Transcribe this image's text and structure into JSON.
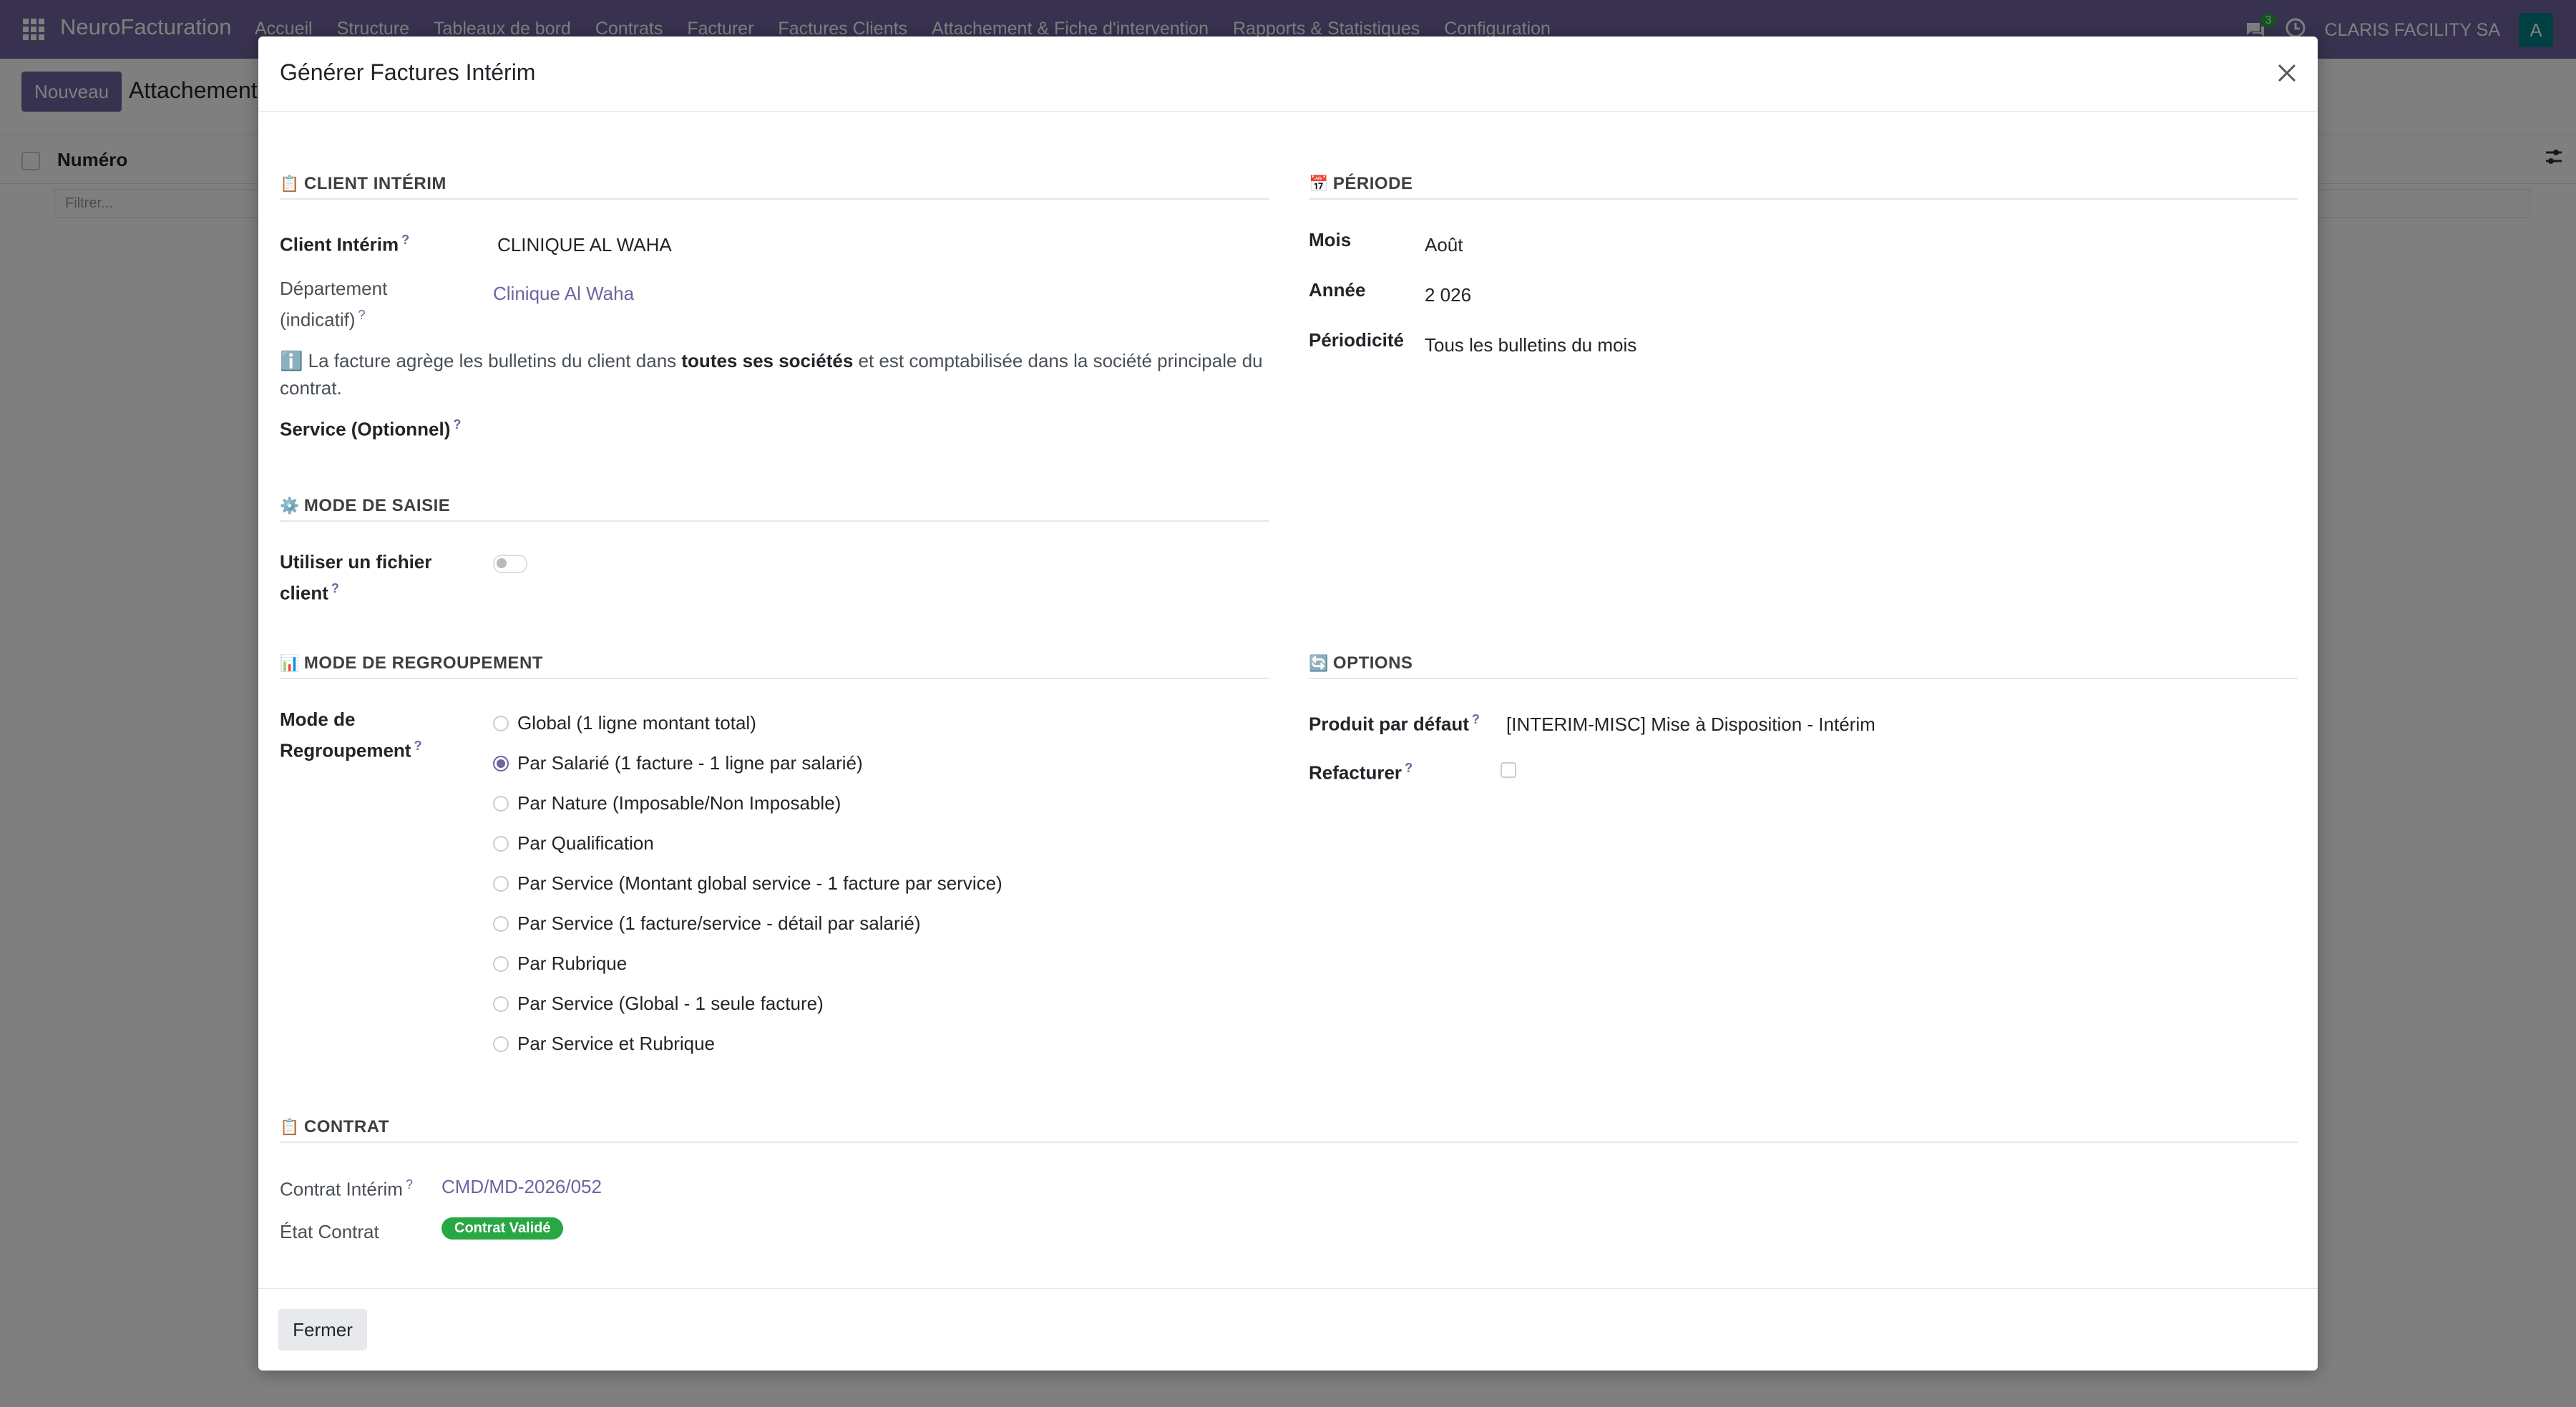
{
  "navbar": {
    "brand": "NeuroFacturation",
    "menu": [
      "Accueil",
      "Structure",
      "Tableaux de bord",
      "Contrats",
      "Facturer",
      "Factures Clients",
      "Attachement & Fiche d'intervention",
      "Rapports & Statistiques",
      "Configuration"
    ],
    "chat_count": "3",
    "company": "CLARIS FACILITY SA",
    "avatar_letter": "A"
  },
  "control_panel": {
    "new_button": "Nouveau",
    "breadcrumb": "Attachement",
    "column_numero": "Numéro",
    "filter_placeholder": "Filtrer..."
  },
  "modal": {
    "title": "Générer Factures Intérim",
    "sections": {
      "client": {
        "title": "CLIENT INTÉRIM",
        "icon": "📋",
        "client_label": "Client Intérim",
        "client_value": "CLINIQUE AL WAHA",
        "dept_label_1": "Département",
        "dept_label_2": "(indicatif)",
        "dept_value": "Clinique Al Waha",
        "info_icon": "ℹ️",
        "info_part1": "La facture agrège les bulletins du client dans ",
        "info_bold": "toutes ses sociétés",
        "info_part2": " et est comptabilisée dans la société principale du",
        "info_line2": "contrat.",
        "service_label": "Service (Optionnel)"
      },
      "periode": {
        "title": "PÉRIODE",
        "icon": "📅",
        "mois_label": "Mois",
        "mois_value": "Août",
        "annee_label": "Année",
        "annee_value": "2 026",
        "periodicite_label": "Périodicité",
        "periodicite_value": "Tous les bulletins du mois"
      },
      "saisie": {
        "title": "MODE DE SAISIE",
        "icon": "⚙️",
        "label_1": "Utiliser un fichier",
        "label_2": "client",
        "toggle_on": false
      },
      "regroupement": {
        "title": "MODE DE REGROUPEMENT",
        "icon": "📊",
        "label_1": "Mode de",
        "label_2": "Regroupement",
        "options": [
          {
            "label": "Global (1 ligne montant total)",
            "checked": false
          },
          {
            "label": "Par Salarié (1 facture - 1 ligne par salarié)",
            "checked": true
          },
          {
            "label": "Par Nature (Imposable/Non Imposable)",
            "checked": false
          },
          {
            "label": "Par Qualification",
            "checked": false
          },
          {
            "label": "Par Service (Montant global service - 1 facture par service)",
            "checked": false
          },
          {
            "label": "Par Service (1 facture/service - détail par salarié)",
            "checked": false
          },
          {
            "label": "Par Rubrique",
            "checked": false
          },
          {
            "label": "Par Service (Global - 1 seule facture)",
            "checked": false
          },
          {
            "label": "Par Service et Rubrique",
            "checked": false
          }
        ]
      },
      "options": {
        "title": "OPTIONS",
        "icon": "🔄",
        "produit_label": "Produit par défaut",
        "produit_value": "[INTERIM-MISC] Mise à Disposition - Intérim",
        "refacturer_label": "Refacturer",
        "refacturer_checked": false
      },
      "contrat": {
        "title": "CONTRAT",
        "icon": "📋",
        "contrat_label": "Contrat Intérim",
        "contrat_value": "CMD/MD-2026/052",
        "etat_label": "État Contrat",
        "etat_value": "Contrat Validé"
      }
    },
    "close_button": "Fermer"
  },
  "colors": {
    "brand": "#71639e",
    "success": "#28a745"
  }
}
